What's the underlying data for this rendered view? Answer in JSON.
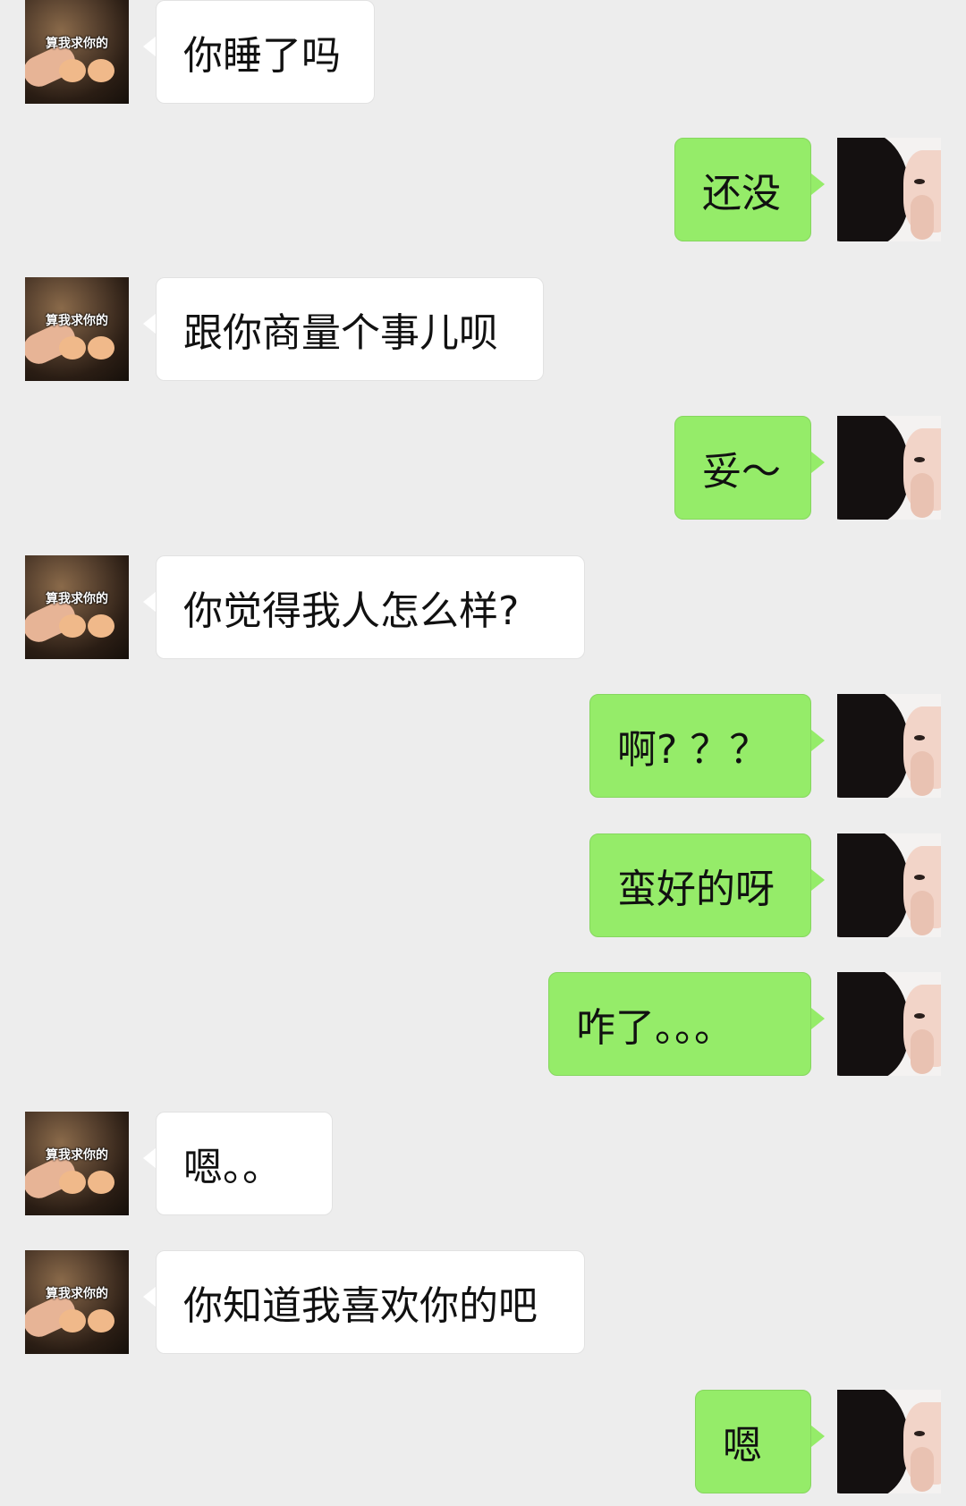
{
  "messages": [
    {
      "side": "left",
      "text": "你睡了吗"
    },
    {
      "side": "right",
      "text": "还没"
    },
    {
      "side": "left",
      "text": "跟你商量个事儿呗"
    },
    {
      "side": "right",
      "text": "妥～"
    },
    {
      "side": "left",
      "text": "你觉得我人怎么样?"
    },
    {
      "side": "right",
      "text": "啊? ？？"
    },
    {
      "side": "right",
      "text": "蛮好的呀"
    },
    {
      "side": "right",
      "text": "咋了。。。"
    },
    {
      "side": "left",
      "text": "嗯。。"
    },
    {
      "side": "left",
      "text": "你知道我喜欢你的吧"
    },
    {
      "side": "right",
      "text": "嗯"
    }
  ],
  "avatars": {
    "left": {
      "caption": "算我求你的",
      "icon": "cat-avatar"
    },
    "right": {
      "icon": "girl-avatar"
    }
  },
  "colors": {
    "background": "#ededed",
    "incoming_bubble": "#ffffff",
    "outgoing_bubble": "#95ec69"
  }
}
